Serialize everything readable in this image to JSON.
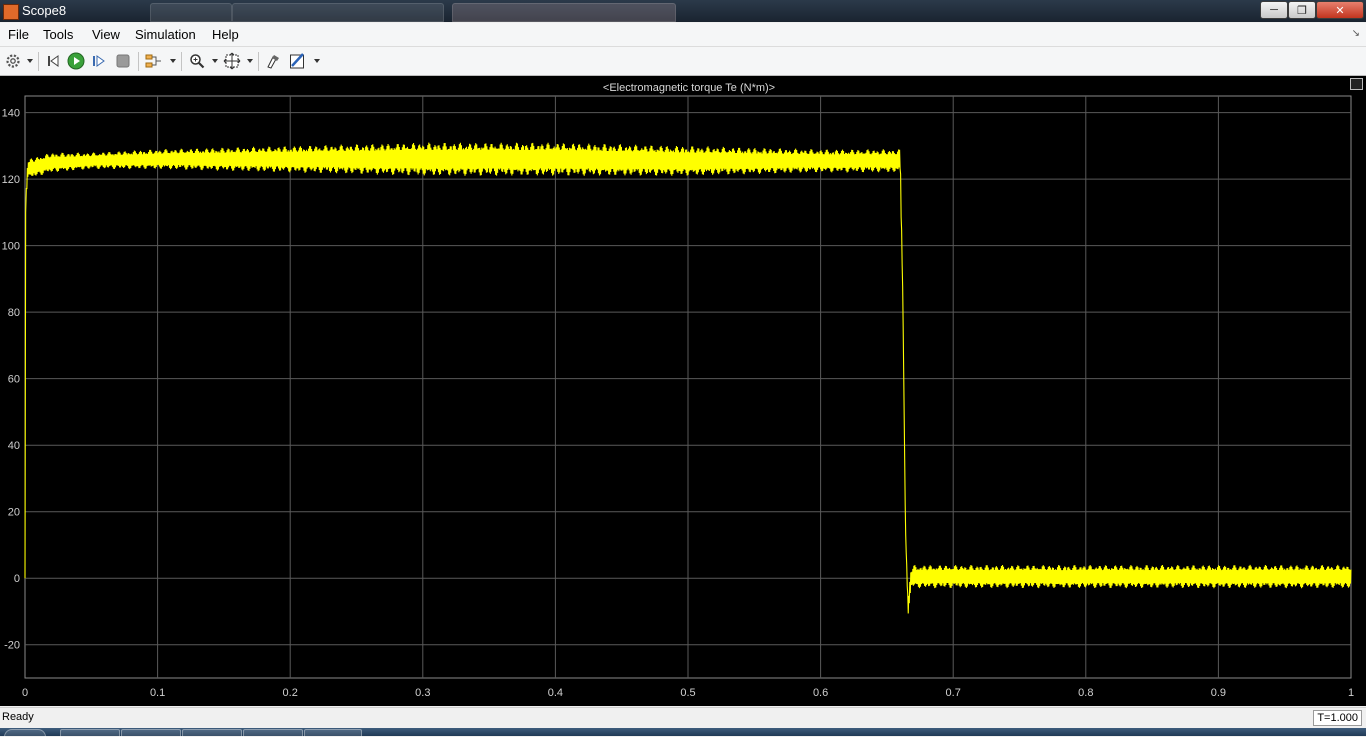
{
  "window": {
    "title": "Scope8"
  },
  "menu": [
    "File",
    "Tools",
    "View",
    "Simulation",
    "Help"
  ],
  "toolbar": {
    "icons": [
      "gear-icon",
      "step-back-icon",
      "run-icon",
      "step-forward-icon",
      "stop-icon",
      "signal-selector-icon",
      "zoom-icon",
      "autoscale-icon",
      "highlight-icon",
      "style-icon"
    ]
  },
  "colors": {
    "trace": "#ffff00",
    "background": "#000000",
    "grid": "#5a5a5a",
    "axis_text": "#d0d0d0"
  },
  "status": {
    "text": "Ready",
    "time": "T=1.000"
  },
  "chart_data": {
    "type": "line",
    "title": "<Electromagnetic torque Te (N*m)>",
    "xlim": [
      0,
      1
    ],
    "ylim": [
      -30,
      145
    ],
    "x_ticks": [
      0,
      0.1,
      0.2,
      0.3,
      0.4,
      0.5,
      0.6,
      0.7,
      0.8,
      0.9,
      1
    ],
    "x_tick_labels": [
      "0",
      "0.1",
      "0.2",
      "0.3",
      "0.4",
      "0.5",
      "0.6",
      "0.7",
      "0.8",
      "0.9",
      "1"
    ],
    "y_ticks": [
      -20,
      0,
      20,
      40,
      60,
      80,
      100,
      120,
      140
    ],
    "y_tick_labels": [
      "-20",
      "0",
      "20",
      "40",
      "60",
      "80",
      "100",
      "120",
      "140"
    ],
    "grid": true,
    "series": [
      {
        "color": "#ffff00",
        "envelope_x": [
          0,
          0.002,
          0.02,
          0.05,
          0.1,
          0.2,
          0.3,
          0.4,
          0.5,
          0.6,
          0.66,
          0.662,
          0.664,
          0.666,
          0.668,
          0.67,
          0.7,
          0.8,
          0.9,
          1.0
        ],
        "envelope_upper": [
          110,
          126,
          128,
          128,
          129,
          130,
          131,
          131,
          130,
          129,
          129,
          85,
          15,
          -8,
          3,
          4,
          4,
          4,
          4,
          4
        ],
        "envelope_lower": [
          110,
          120,
          122,
          123,
          123,
          122,
          121,
          121,
          121,
          122,
          122,
          85,
          15,
          -11,
          -3,
          -3,
          -3,
          -3,
          -3,
          -3
        ]
      }
    ]
  }
}
